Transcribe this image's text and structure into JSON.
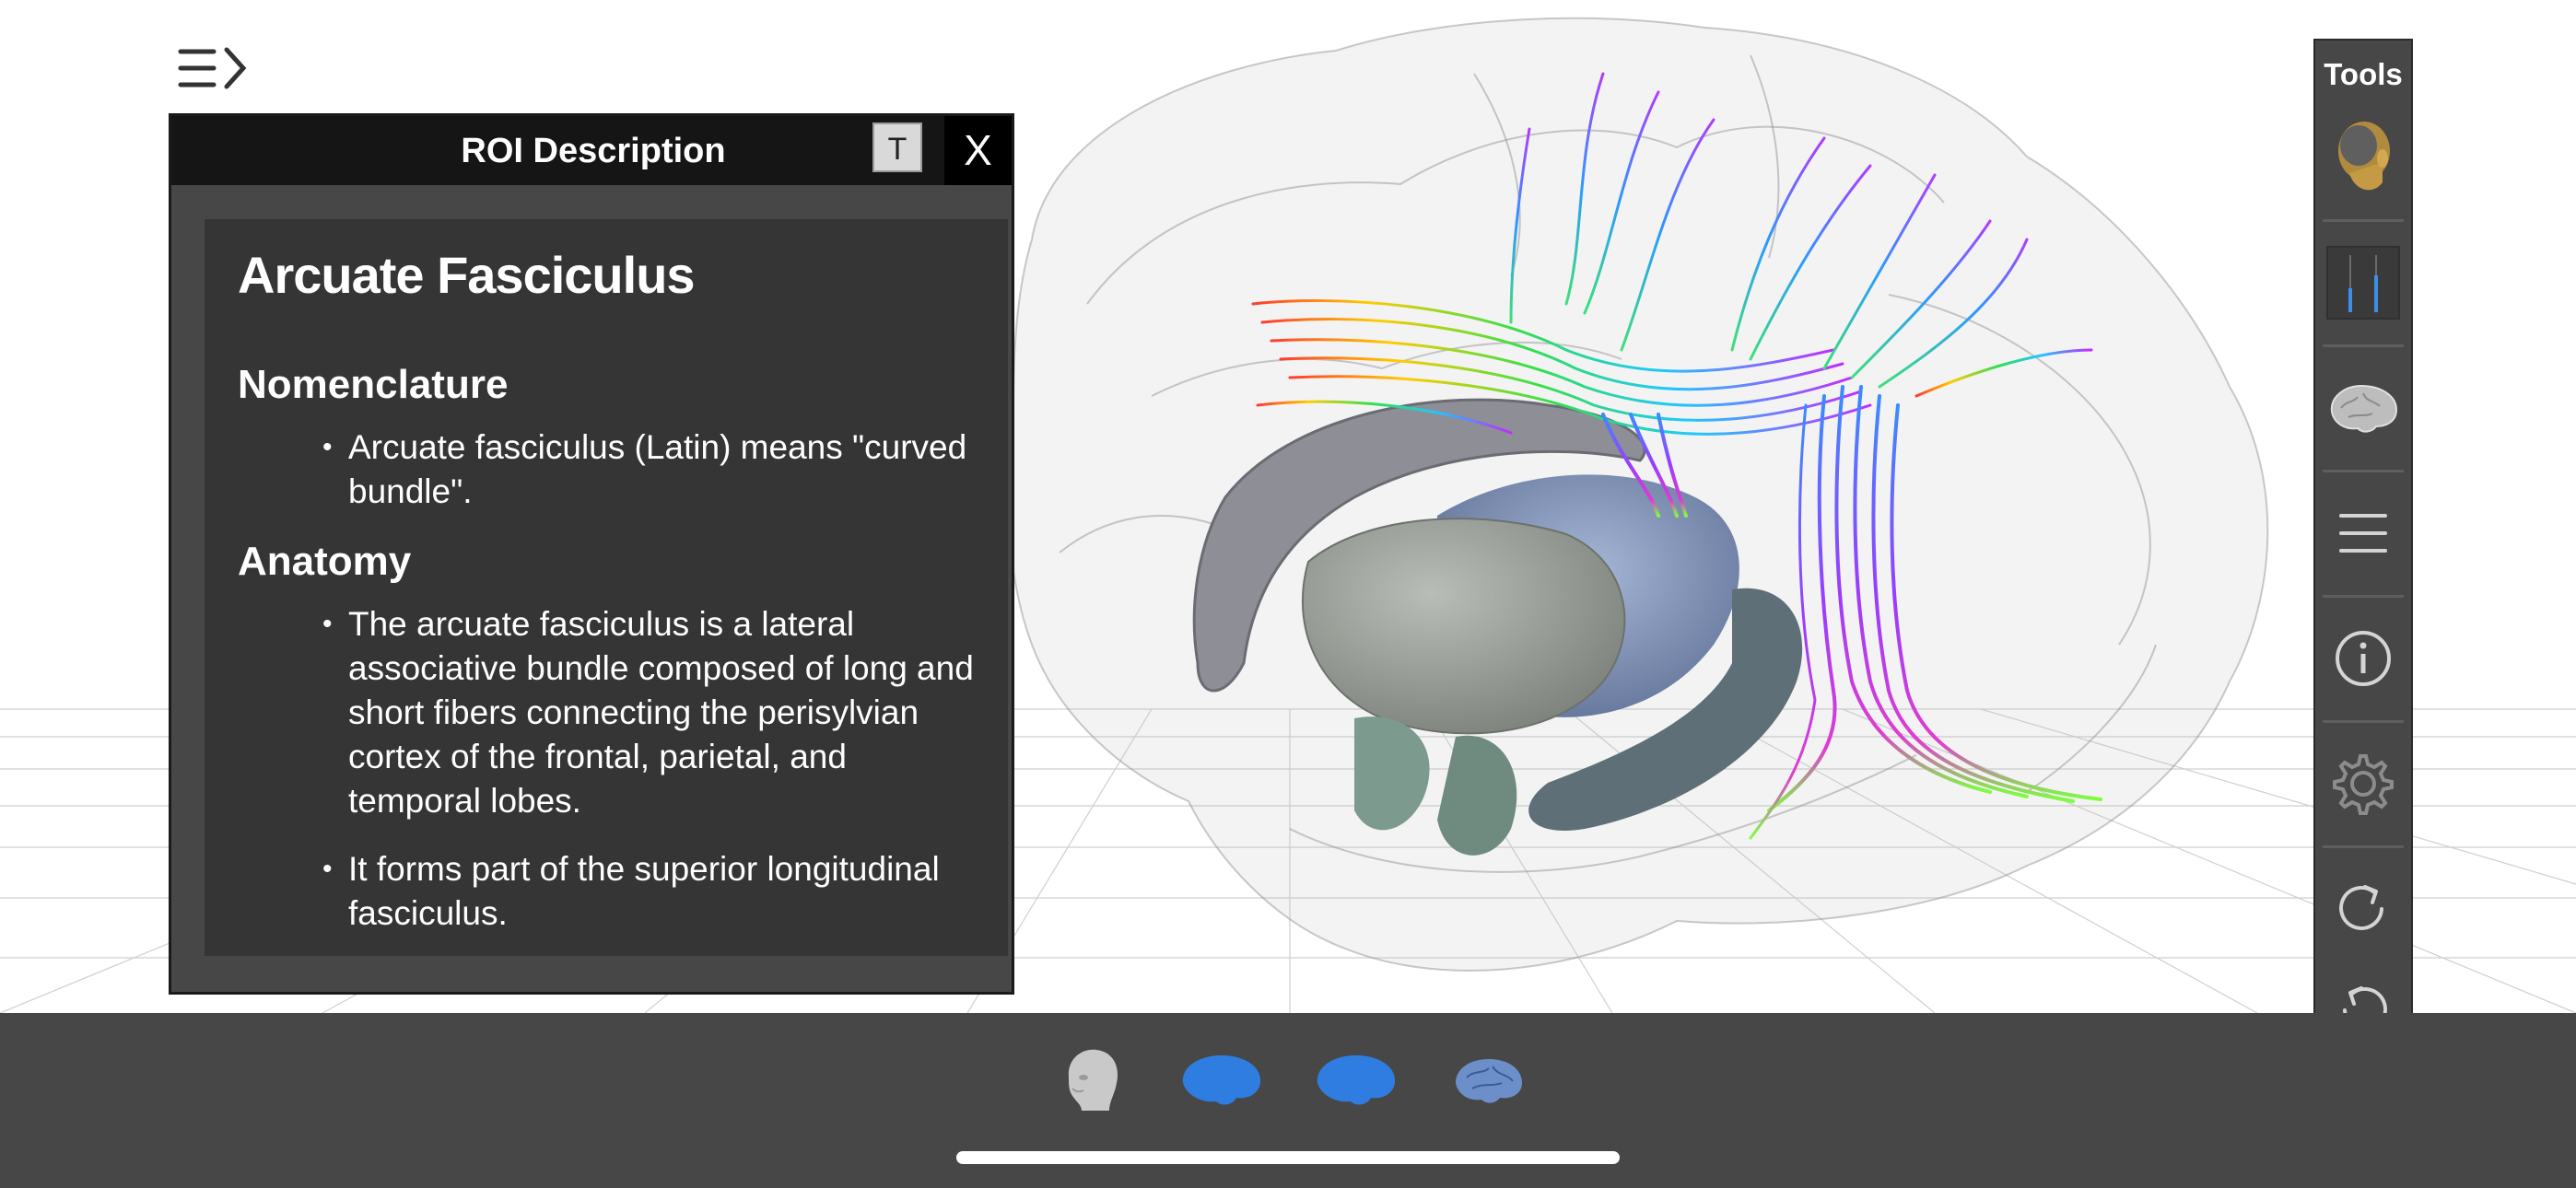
{
  "header": {
    "menu_icon": "menu-expand-icon"
  },
  "roi_panel": {
    "title": "ROI Description",
    "text_size_label": "T",
    "close_label": "X",
    "structure_name": "Arcuate Fasciculus",
    "sections": [
      {
        "heading": "Nomenclature",
        "items": [
          "Arcuate fasciculus (Latin) means \"curved bundle\"."
        ]
      },
      {
        "heading": "Anatomy",
        "items": [
          "The arcuate fasciculus is a lateral associative bundle composed of long and short fibers connecting the perisylvian cortex of the frontal, parietal, and temporal lobes.",
          "It forms part of the superior longitudinal fasciculus."
        ]
      }
    ]
  },
  "tools": {
    "title": "Tools",
    "items": [
      {
        "icon": "head-model-icon"
      },
      {
        "icon": "sliders-icon"
      },
      {
        "icon": "brain-icon"
      },
      {
        "icon": "list-icon"
      },
      {
        "icon": "info-icon"
      },
      {
        "icon": "gear-icon"
      },
      {
        "icon": "redo-icon"
      },
      {
        "icon": "undo-icon"
      }
    ]
  },
  "bottom_bar": {
    "models": [
      "head-icon",
      "brain-left-icon",
      "brain-right-icon",
      "brain-small-icon"
    ]
  },
  "colors": {
    "panel_bg": "#474747",
    "panel_header": "#151515",
    "content_bg": "#353535",
    "accent_blue": "#2f7de0"
  }
}
